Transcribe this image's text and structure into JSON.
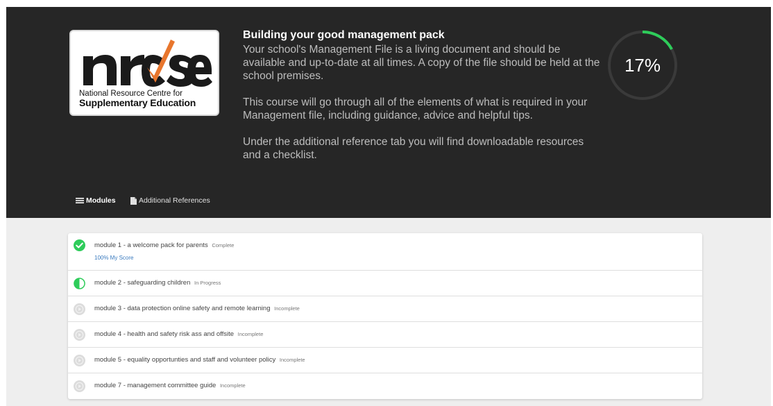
{
  "logo": {
    "wordmark": "nrcse",
    "line1": "National Resource Centre for",
    "line2": "Supplementary Education"
  },
  "course": {
    "title": "Building your good management pack",
    "description": [
      "Your school's Management File is a living document and should be available and up-to-date at all times. A copy of the file should be held at the school premises.",
      "This course will go through all of the elements of what is required in your Management file, including guidance, advice and helpful tips.",
      "Under the additional reference tab you will find downloadable resources and a checklist."
    ]
  },
  "progress": {
    "value": 0.17,
    "label": "17%"
  },
  "tabs": {
    "modules": {
      "label": "Modules",
      "icon": "list-icon"
    },
    "references": {
      "label": "Additional References",
      "icon": "document-icon"
    }
  },
  "modules": [
    {
      "title": "module 1 - a welcome pack for parents",
      "status": "Complete",
      "score": "100% My Score",
      "icon": "check-circle-icon"
    },
    {
      "title": "module 2 - safeguarding children",
      "status": "In Progress",
      "icon": "half-circle-icon"
    },
    {
      "title": "module 3 - data protection online safety and remote learning",
      "status": "Incomplete",
      "icon": "play-circle-icon"
    },
    {
      "title": "module 4 - health and safety risk ass and offsite",
      "status": "Incomplete",
      "icon": "play-circle-icon"
    },
    {
      "title": "module 5 - equality opportunties and staff and volunteer policy",
      "status": "Incomplete",
      "icon": "play-circle-icon"
    },
    {
      "title": "module 7 - management committee guide",
      "status": "Incomplete",
      "icon": "play-circle-icon"
    }
  ],
  "colors": {
    "accent_green": "#2ecc5a",
    "hero_bg": "#262626",
    "logo_orange": "#e8762d",
    "incomplete_grey": "#d9d9d9"
  }
}
